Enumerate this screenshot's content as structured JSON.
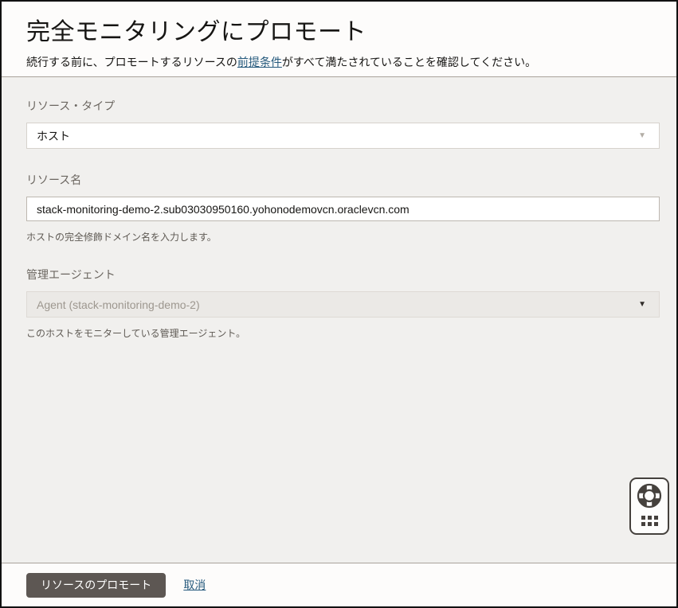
{
  "header": {
    "title": "完全モニタリングにプロモート",
    "subtitle": {
      "before": "続行する前に、プロモートするリソースの",
      "link": "前提条件",
      "after": "がすべて満たされていることを確認してください。"
    }
  },
  "form": {
    "resource_type": {
      "label": "リソース・タイプ",
      "value": "ホスト"
    },
    "resource_name": {
      "label": "リソース名",
      "value": "stack-monitoring-demo-2.sub03030950160.yohonodemovcn.oraclevcn.com",
      "help": "ホストの完全修飾ドメイン名を入力します。"
    },
    "management_agent": {
      "label": "管理エージェント",
      "value": "Agent (stack-monitoring-demo-2)",
      "state": "disabled",
      "help": "このホストをモニターしている管理エージェント。"
    }
  },
  "footer": {
    "promote_button": "リソースのプロモート",
    "cancel_link": "取消"
  },
  "icons": {
    "chevron": "chevron-down-icon",
    "help": "life-preserver-icon",
    "launcher": "grid-dots-icon"
  },
  "colors": {
    "link": "#265a7d",
    "primary_button_bg": "#5d5753",
    "page_bg": "#f1f0ee",
    "header_bg": "#fdfcfb",
    "disabled_field_bg": "#ebe9e6",
    "icon_dark": "#45413d"
  }
}
